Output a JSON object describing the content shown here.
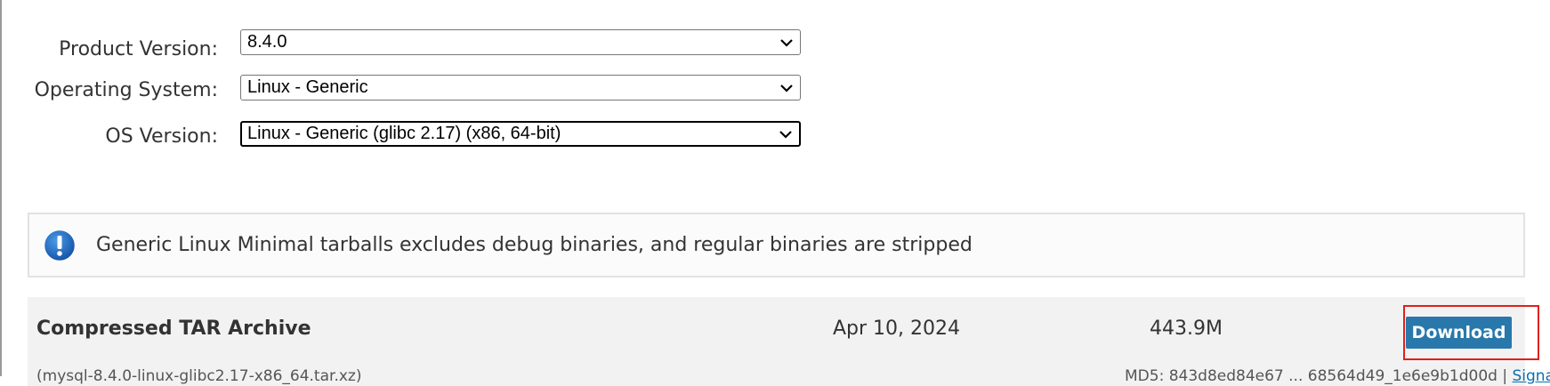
{
  "form": {
    "product_version": {
      "label": "Product Version:",
      "value": "8.4.0"
    },
    "operating_system": {
      "label": "Operating System:",
      "value": "Linux - Generic"
    },
    "os_version": {
      "label": "OS Version:",
      "value": "Linux - Generic (glibc 2.17) (x86, 64-bit)"
    }
  },
  "notice": {
    "icon": "info-exclamation-icon",
    "text": "Generic Linux Minimal tarballs excludes debug binaries, and regular binaries are stripped"
  },
  "downloads": {
    "row": {
      "name": "Compressed TAR Archive",
      "date": "Apr 10, 2024",
      "size": "443.9M",
      "filename": "(mysql-8.4.0-linux-glibc2.17-x86_64.tar.xz)",
      "md5": "MD5: 843d8ed84e67 ... 68564d49_1e6e9b1d00d",
      "signature_label": "Signature",
      "button_label": "Download"
    }
  },
  "colors": {
    "button": "#2878ac",
    "highlight": "#e0201b",
    "notice_icon": "#1a6fc2",
    "row_background": "#f2f2f2"
  }
}
